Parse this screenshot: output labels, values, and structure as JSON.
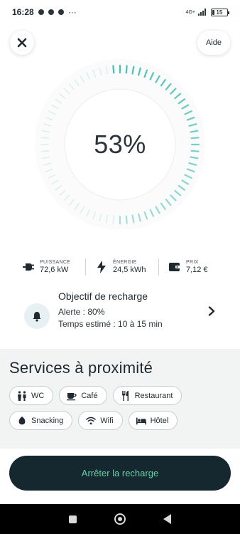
{
  "status_bar": {
    "time": "16:28",
    "network": "4G+",
    "battery": "15",
    "battery_level": 0.15,
    "more": "···"
  },
  "header": {
    "close_icon": "close-icon",
    "help_label": "Aide"
  },
  "gauge": {
    "percent_label": "53%",
    "percent_value": 53,
    "accent": "#3cc3b0",
    "track": "#d9f2ee"
  },
  "stats": [
    {
      "icon": "plug-icon",
      "label": "PUISSANCE",
      "value": "72,6 kW"
    },
    {
      "icon": "bolt-icon",
      "label": "ÉNERGIE",
      "value": "24,5 kWh"
    },
    {
      "icon": "wallet-icon",
      "label": "PRIX",
      "value": "7,12 €"
    }
  ],
  "target": {
    "title": "Objectif de recharge",
    "alert": "Alerte : 80%",
    "eta": "Temps estimé : 10 à 15 min"
  },
  "services": {
    "title": "Services à proximité",
    "chips": [
      {
        "icon": "wc-icon",
        "label": "WC"
      },
      {
        "icon": "coffee-icon",
        "label": "Café"
      },
      {
        "icon": "restaurant-icon",
        "label": "Restaurant"
      },
      {
        "icon": "snacking-icon",
        "label": "Snacking"
      },
      {
        "icon": "wifi-icon",
        "label": "Wifi"
      },
      {
        "icon": "bed-icon",
        "label": "Hôtel"
      }
    ]
  },
  "actions": {
    "stop_label": "Arrêter la recharge",
    "stop_bg": "#16282f",
    "stop_text_color": "#5fd3a5"
  }
}
